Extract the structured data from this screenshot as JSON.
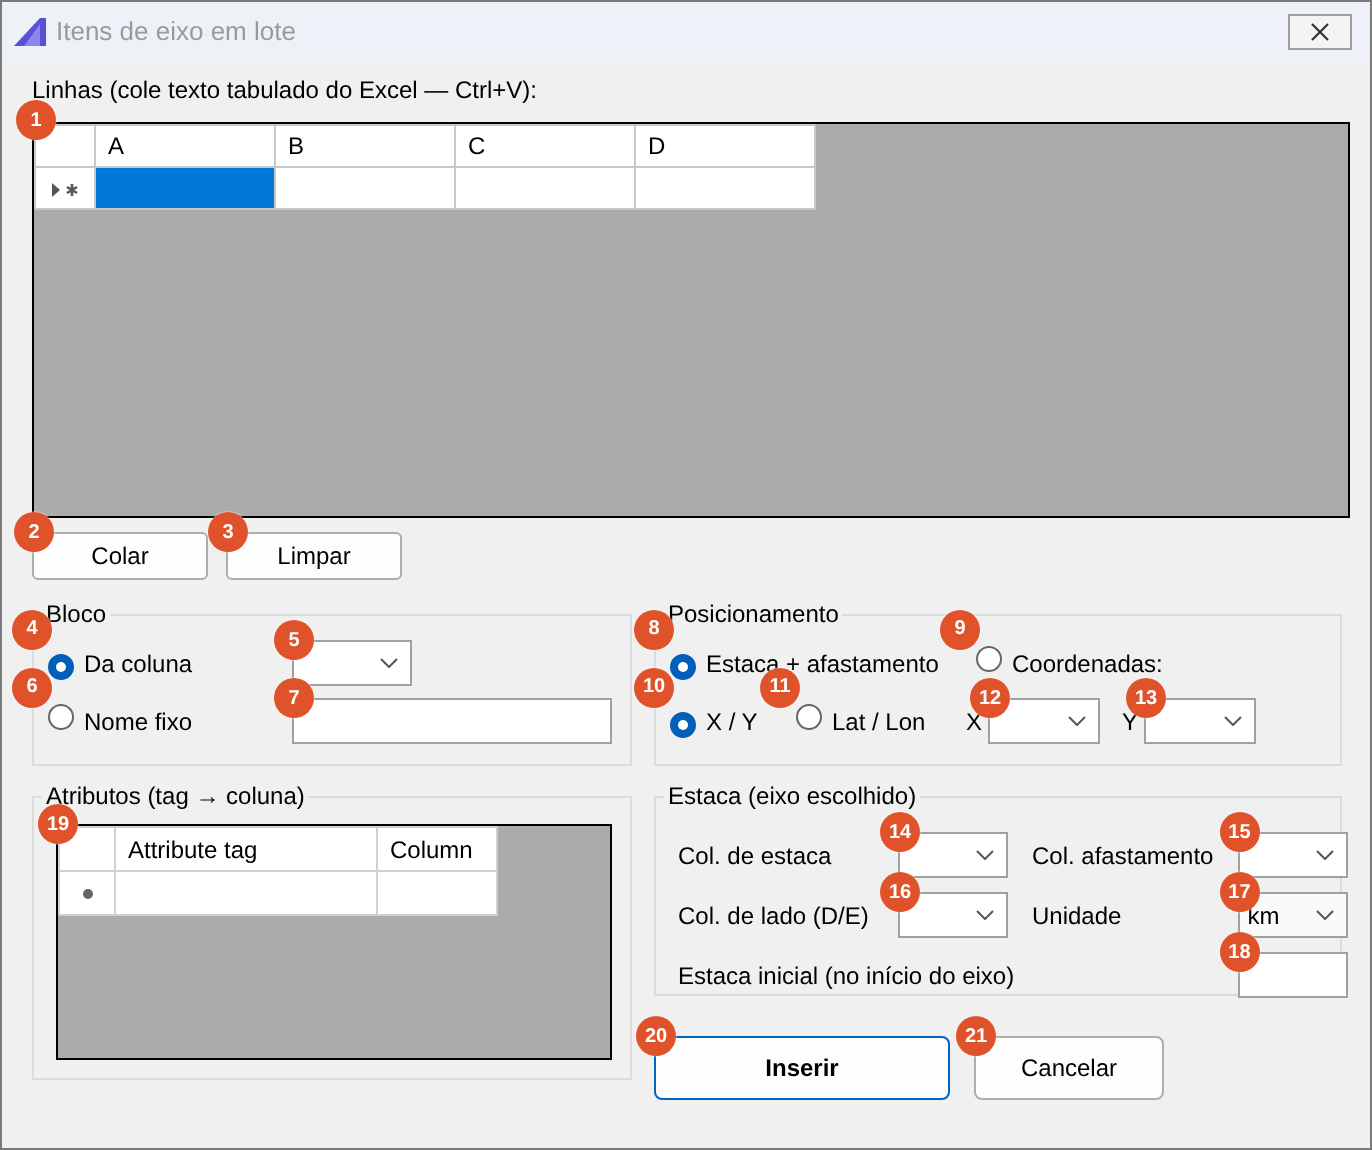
{
  "window": {
    "title": "Itens de eixo em lote"
  },
  "lines": {
    "label": "Linhas (cole texto tabulado do Excel — Ctrl+V):",
    "badge": "1",
    "columns": [
      "A",
      "B",
      "C",
      "D"
    ],
    "rows": [
      {
        "cells": [
          {
            "selected": true
          },
          {
            "selected": false
          },
          {
            "selected": false
          },
          {
            "selected": false
          }
        ]
      }
    ]
  },
  "grid_buttons": [
    {
      "label": "Colar",
      "badge": "2"
    },
    {
      "label": "Limpar",
      "badge": "3"
    }
  ],
  "bloco": {
    "title": "Bloco",
    "options": [
      {
        "label": "Da coluna",
        "selected": true,
        "badge": "4",
        "control": {
          "kind": "combo",
          "badge": "5"
        }
      },
      {
        "label": "Nome fixo",
        "selected": false,
        "badge": "6",
        "control": {
          "kind": "text",
          "badge": "7"
        }
      }
    ]
  },
  "posicionamento": {
    "title": "Posicionamento",
    "mode_options": [
      {
        "label": "Estaca + afastamento",
        "selected": true,
        "badge": "8"
      },
      {
        "label": "Coordenadas:",
        "selected": false,
        "badge": "9"
      }
    ],
    "coord_options": [
      {
        "label": "X / Y",
        "selected": true,
        "badge": "10"
      },
      {
        "label": "Lat / Lon",
        "selected": false,
        "badge": "11"
      }
    ],
    "coord_fields": [
      {
        "label": "X",
        "badge": "12"
      },
      {
        "label": "Y",
        "badge": "13"
      }
    ]
  },
  "atributos": {
    "title": "Atributos (tag → coluna)",
    "badge": "19",
    "columns": [
      "Attribute tag",
      "Column"
    ]
  },
  "estaca": {
    "title": "Estaca (eixo escolhido)",
    "fields": [
      {
        "label": "Col. de estaca",
        "kind": "combo",
        "badge": "14"
      },
      {
        "label": "Col. afastamento",
        "kind": "combo",
        "badge": "15"
      },
      {
        "label": "Col. de lado (D/E)",
        "kind": "combo",
        "badge": "16"
      },
      {
        "label": "Unidade",
        "kind": "combo",
        "value": "km",
        "badge": "17"
      },
      {
        "label": "Estaca inicial (no início do eixo)",
        "kind": "text",
        "badge": "18"
      }
    ]
  },
  "actions": [
    {
      "label": "Inserir",
      "default": true,
      "badge": "20"
    },
    {
      "label": "Cancelar",
      "default": false,
      "badge": "21"
    }
  ]
}
